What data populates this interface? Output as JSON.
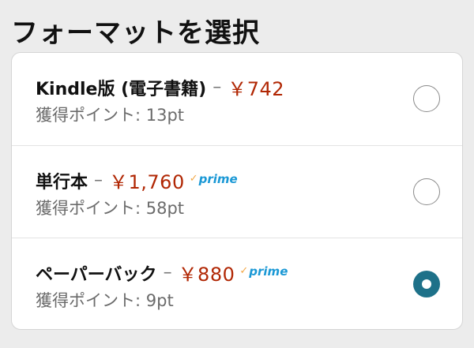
{
  "heading": "フォーマットを選択",
  "colors": {
    "price": "#b12704",
    "prime": "#1a98d5",
    "prime_check": "#f3a847",
    "selected_radio": "#1e7189"
  },
  "options": [
    {
      "format": "Kindle版 (電子書籍)",
      "separator": "–",
      "price": "￥742",
      "prime": null,
      "points": "獲得ポイント: 13pt",
      "selected": false
    },
    {
      "format": "単行本",
      "separator": "–",
      "price": "￥1,760",
      "prime": {
        "check": "✓",
        "label": "prime"
      },
      "points": "獲得ポイント: 58pt",
      "selected": false
    },
    {
      "format": "ペーパーバック",
      "separator": "–",
      "price": "￥880",
      "prime": {
        "check": "✓",
        "label": "prime"
      },
      "points": "獲得ポイント: 9pt",
      "selected": true
    }
  ]
}
